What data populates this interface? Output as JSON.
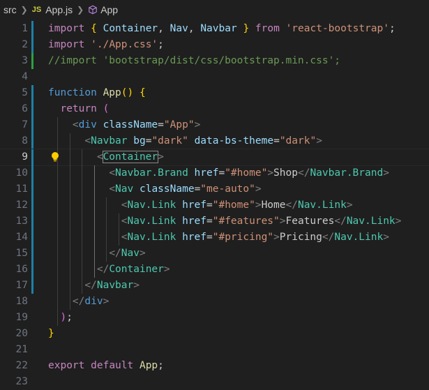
{
  "breadcrumb": {
    "folder": "src",
    "file_badge": "JS",
    "file": "App.js",
    "symbol": "App"
  },
  "colors": {
    "background": "#1f1f1f",
    "line_number": "#6e7681",
    "modified_gutter": "#1b81a8",
    "added_gutter": "#2ea043"
  },
  "editor": {
    "active_line": 9,
    "lines": [
      {
        "n": "1",
        "tokens": [
          [
            "imp",
            "import"
          ],
          [
            "txt",
            " "
          ],
          [
            "br1",
            "{"
          ],
          [
            "txt",
            " "
          ],
          [
            "var",
            "Container"
          ],
          [
            "txt",
            ", "
          ],
          [
            "var",
            "Nav"
          ],
          [
            "txt",
            ", "
          ],
          [
            "var",
            "Navbar"
          ],
          [
            "txt",
            " "
          ],
          [
            "br1",
            "}"
          ],
          [
            "txt",
            " "
          ],
          [
            "imp",
            "from"
          ],
          [
            "txt",
            " "
          ],
          [
            "str",
            "'react-bootstrap'"
          ],
          [
            "txt",
            ";"
          ]
        ]
      },
      {
        "n": "2",
        "tokens": [
          [
            "imp",
            "import"
          ],
          [
            "txt",
            " "
          ],
          [
            "str",
            "'./App.css'"
          ],
          [
            "txt",
            ";"
          ]
        ]
      },
      {
        "n": "3",
        "tokens": [
          [
            "cmt",
            "//import 'bootstrap/dist/css/bootstrap.min.css';"
          ]
        ]
      },
      {
        "n": "4",
        "tokens": []
      },
      {
        "n": "5",
        "tokens": [
          [
            "kw",
            "function"
          ],
          [
            "txt",
            " "
          ],
          [
            "fn",
            "App"
          ],
          [
            "br1",
            "()"
          ],
          [
            "txt",
            " "
          ],
          [
            "br1",
            "{"
          ]
        ]
      },
      {
        "n": "6",
        "tokens": [
          [
            "txt",
            "  "
          ],
          [
            "imp",
            "return"
          ],
          [
            "txt",
            " "
          ],
          [
            "br2",
            "("
          ]
        ]
      },
      {
        "n": "7",
        "tokens": [
          [
            "txt",
            "    "
          ],
          [
            "tagp",
            "<"
          ],
          [
            "kw",
            "div"
          ],
          [
            "txt",
            " "
          ],
          [
            "attr",
            "className"
          ],
          [
            "eq",
            "="
          ],
          [
            "str",
            "\"App\""
          ],
          [
            "tagp",
            ">"
          ]
        ]
      },
      {
        "n": "8",
        "tokens": [
          [
            "txt",
            "      "
          ],
          [
            "tagp",
            "<"
          ],
          [
            "tag",
            "Navbar"
          ],
          [
            "txt",
            " "
          ],
          [
            "attr",
            "bg"
          ],
          [
            "eq",
            "="
          ],
          [
            "str",
            "\"dark\""
          ],
          [
            "txt",
            " "
          ],
          [
            "attr",
            "data-bs-theme"
          ],
          [
            "eq",
            "="
          ],
          [
            "str",
            "\"dark\""
          ],
          [
            "tagp",
            ">"
          ]
        ]
      },
      {
        "n": "9",
        "tokens": [
          [
            "txt",
            "        "
          ],
          [
            "tagp",
            "<"
          ],
          [
            "tag",
            "Container"
          ],
          [
            "tagp",
            ">"
          ]
        ]
      },
      {
        "n": "10",
        "tokens": [
          [
            "txt",
            "          "
          ],
          [
            "tagp",
            "<"
          ],
          [
            "tag",
            "Navbar.Brand"
          ],
          [
            "txt",
            " "
          ],
          [
            "attr",
            "href"
          ],
          [
            "eq",
            "="
          ],
          [
            "str",
            "\"#home\""
          ],
          [
            "tagp",
            ">"
          ],
          [
            "txt",
            "Shop"
          ],
          [
            "tagp",
            "</"
          ],
          [
            "tag",
            "Navbar.Brand"
          ],
          [
            "tagp",
            ">"
          ]
        ]
      },
      {
        "n": "11",
        "tokens": [
          [
            "txt",
            "          "
          ],
          [
            "tagp",
            "<"
          ],
          [
            "tag",
            "Nav"
          ],
          [
            "txt",
            " "
          ],
          [
            "attr",
            "className"
          ],
          [
            "eq",
            "="
          ],
          [
            "str",
            "\"me-auto\""
          ],
          [
            "tagp",
            ">"
          ]
        ]
      },
      {
        "n": "12",
        "tokens": [
          [
            "txt",
            "            "
          ],
          [
            "tagp",
            "<"
          ],
          [
            "tag",
            "Nav.Link"
          ],
          [
            "txt",
            " "
          ],
          [
            "attr",
            "href"
          ],
          [
            "eq",
            "="
          ],
          [
            "str",
            "\"#home\""
          ],
          [
            "tagp",
            ">"
          ],
          [
            "txt",
            "Home"
          ],
          [
            "tagp",
            "</"
          ],
          [
            "tag",
            "Nav.Link"
          ],
          [
            "tagp",
            ">"
          ]
        ]
      },
      {
        "n": "13",
        "tokens": [
          [
            "txt",
            "            "
          ],
          [
            "tagp",
            "<"
          ],
          [
            "tag",
            "Nav.Link"
          ],
          [
            "txt",
            " "
          ],
          [
            "attr",
            "href"
          ],
          [
            "eq",
            "="
          ],
          [
            "str",
            "\"#features\""
          ],
          [
            "tagp",
            ">"
          ],
          [
            "txt",
            "Features"
          ],
          [
            "tagp",
            "</"
          ],
          [
            "tag",
            "Nav.Link"
          ],
          [
            "tagp",
            ">"
          ]
        ]
      },
      {
        "n": "14",
        "tokens": [
          [
            "txt",
            "            "
          ],
          [
            "tagp",
            "<"
          ],
          [
            "tag",
            "Nav.Link"
          ],
          [
            "txt",
            " "
          ],
          [
            "attr",
            "href"
          ],
          [
            "eq",
            "="
          ],
          [
            "str",
            "\"#pricing\""
          ],
          [
            "tagp",
            ">"
          ],
          [
            "txt",
            "Pricing"
          ],
          [
            "tagp",
            "</"
          ],
          [
            "tag",
            "Nav.Link"
          ],
          [
            "tagp",
            ">"
          ]
        ]
      },
      {
        "n": "15",
        "tokens": [
          [
            "txt",
            "          "
          ],
          [
            "tagp",
            "</"
          ],
          [
            "tag",
            "Nav"
          ],
          [
            "tagp",
            ">"
          ]
        ]
      },
      {
        "n": "16",
        "tokens": [
          [
            "txt",
            "        "
          ],
          [
            "tagp",
            "</"
          ],
          [
            "tag",
            "Container"
          ],
          [
            "tagp",
            ">"
          ]
        ]
      },
      {
        "n": "17",
        "tokens": [
          [
            "txt",
            "      "
          ],
          [
            "tagp",
            "</"
          ],
          [
            "tag",
            "Navbar"
          ],
          [
            "tagp",
            ">"
          ]
        ]
      },
      {
        "n": "18",
        "tokens": [
          [
            "txt",
            "    "
          ],
          [
            "tagp",
            "</"
          ],
          [
            "kw",
            "div"
          ],
          [
            "tagp",
            ">"
          ]
        ]
      },
      {
        "n": "19",
        "tokens": [
          [
            "txt",
            "  "
          ],
          [
            "br2",
            ")"
          ],
          [
            "txt",
            ";"
          ]
        ]
      },
      {
        "n": "20",
        "tokens": [
          [
            "br1",
            "}"
          ]
        ]
      },
      {
        "n": "21",
        "tokens": []
      },
      {
        "n": "22",
        "tokens": [
          [
            "imp",
            "export"
          ],
          [
            "txt",
            " "
          ],
          [
            "imp",
            "default"
          ],
          [
            "txt",
            " "
          ],
          [
            "fn",
            "App"
          ],
          [
            "txt",
            ";"
          ]
        ]
      },
      {
        "n": "23",
        "tokens": []
      }
    ]
  }
}
